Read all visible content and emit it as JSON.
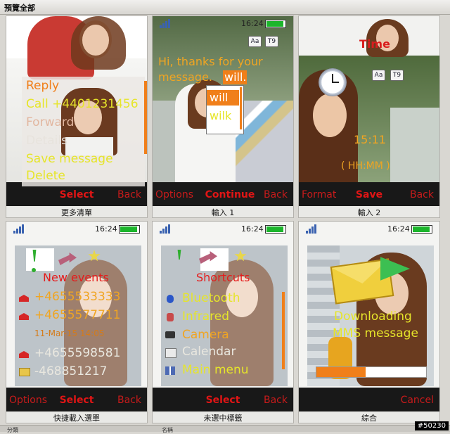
{
  "window": {
    "title": "預覽全部"
  },
  "status": {
    "time": "16:24"
  },
  "cells": {
    "more_menu": {
      "caption": "更多清單",
      "menu": [
        "Reply",
        "Call +4401231456",
        "Forward",
        "Details",
        "Save message",
        "Delete"
      ],
      "softkeys": {
        "center": "Select",
        "right": "Back"
      }
    },
    "input1": {
      "caption": "輸入 1",
      "message": [
        "Hi, thanks for your",
        "message."
      ],
      "highlight": "will.",
      "suggestions": [
        "will",
        "wilk"
      ],
      "badges": [
        "Aa",
        "T9"
      ],
      "softkeys": {
        "left": "Options",
        "center": "Continue",
        "right": "Back"
      }
    },
    "input2": {
      "caption": "輸入 2",
      "header": "Time",
      "time_value": "15:11",
      "time_format": "( HH:MM )",
      "badges": [
        "Aa",
        "T9"
      ],
      "softkeys": {
        "left": "Format",
        "center": "Save",
        "right": "Back"
      }
    },
    "quick_menu": {
      "caption": "快捷載入選單",
      "title": "New events",
      "items": [
        "+4655533333",
        "+4655577711",
        "11-Mar-15  14:05",
        "+4655598581",
        "-468851217"
      ],
      "softkeys": {
        "left": "Options",
        "center": "Select",
        "right": "Back"
      }
    },
    "unselected_tabs": {
      "caption": "未選中標籤",
      "title": "Shortcuts",
      "items": [
        "Bluetooth",
        "Infrared",
        "Camera",
        "Calendar",
        "Main menu"
      ],
      "softkeys": {
        "center": "Select",
        "right": "Back"
      }
    },
    "composite": {
      "caption": "綜合",
      "progress_text": [
        "Downloading",
        "MMS message"
      ],
      "progress": 0.45,
      "softkeys": {
        "right": "Cancel"
      }
    }
  },
  "bottom_labels": [
    "分類",
    "名稱"
  ],
  "watermark": "#50230",
  "colors": {
    "menu_text": "#e2e22a",
    "orange": "#f07f1a",
    "red": "#d91d1d"
  }
}
